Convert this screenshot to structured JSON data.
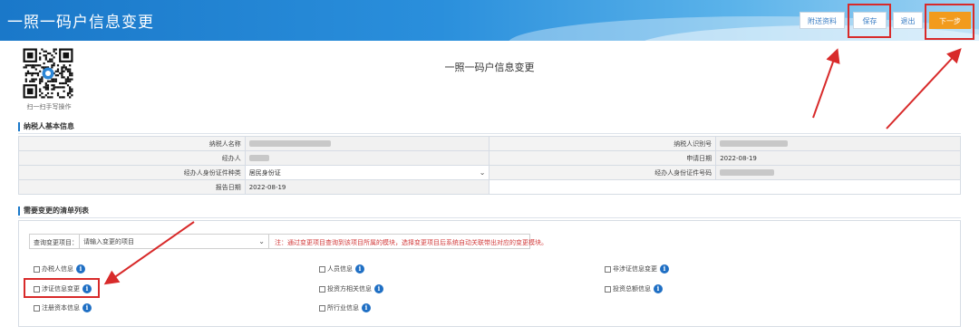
{
  "header": {
    "title": "一照一码户信息变更",
    "buttons": {
      "attachment": "附送资料",
      "save": "保存",
      "back": "退出",
      "next": "下一步"
    }
  },
  "qr": {
    "caption": "扫一扫手写操作"
  },
  "page_title": "一照一码户信息变更",
  "basic_info": {
    "section_title": "纳税人基本信息",
    "taxpayer_name_label": "纳税人名称",
    "taxpayer_id_label": "纳税人识别号",
    "agent_label": "经办人",
    "apply_date_label": "申请日期",
    "apply_date_value": "2022-08-19",
    "agent_id_type_label": "经办人身份证件种类",
    "agent_id_type_value": "居民身份证",
    "agent_id_no_label": "经办人身份证件号码",
    "report_date_label": "报告日期",
    "report_date_value": "2022-08-19"
  },
  "change_list": {
    "section_title": "需要变更的清单列表",
    "filter_label": "查询变更项目：",
    "filter_placeholder": "请输入变更的项目",
    "filter_note": "注：通过变更项目查询到该项目所属的模块，选择变更项目后系统自动关联带出对应的变更模块。",
    "items": [
      "办税人信息",
      "人员信息",
      "非涉证信息变更",
      "涉证信息变更",
      "投资方相关信息",
      "投资总额信息",
      "注册资本信息",
      "所行业信息"
    ]
  },
  "colors": {
    "accent": "#1a78c9",
    "next_button": "#f29b1d",
    "annotation_red": "#d82a2a",
    "info_icon": "#1f6fc4"
  },
  "icons": [
    "qr-code-icon",
    "info-icon",
    "chevron-down-icon",
    "checkbox-icon"
  ]
}
